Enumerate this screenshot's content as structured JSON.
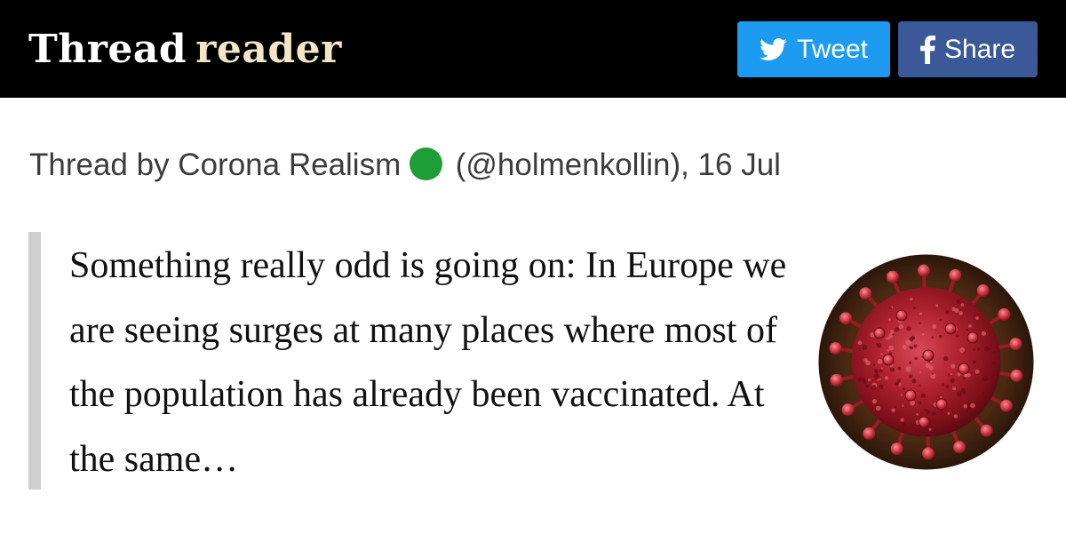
{
  "header": {
    "logo_part1": "Thread",
    "logo_part2": "reader",
    "tweet_label": "Tweet",
    "share_label": "Share",
    "tweet_color": "#1d9bf0",
    "share_color": "#3b5998"
  },
  "thread": {
    "byline_prefix": "Thread by Corona Realism",
    "status_emoji_color": "#1e9e36",
    "byline_suffix": "(@holmenkollin), 16 Jul",
    "excerpt": "Something really odd is going on: In Europe we are seeing surges at many places where most of the population has already been vaccinated. At the same…",
    "image_icon": "coronavirus-image"
  }
}
